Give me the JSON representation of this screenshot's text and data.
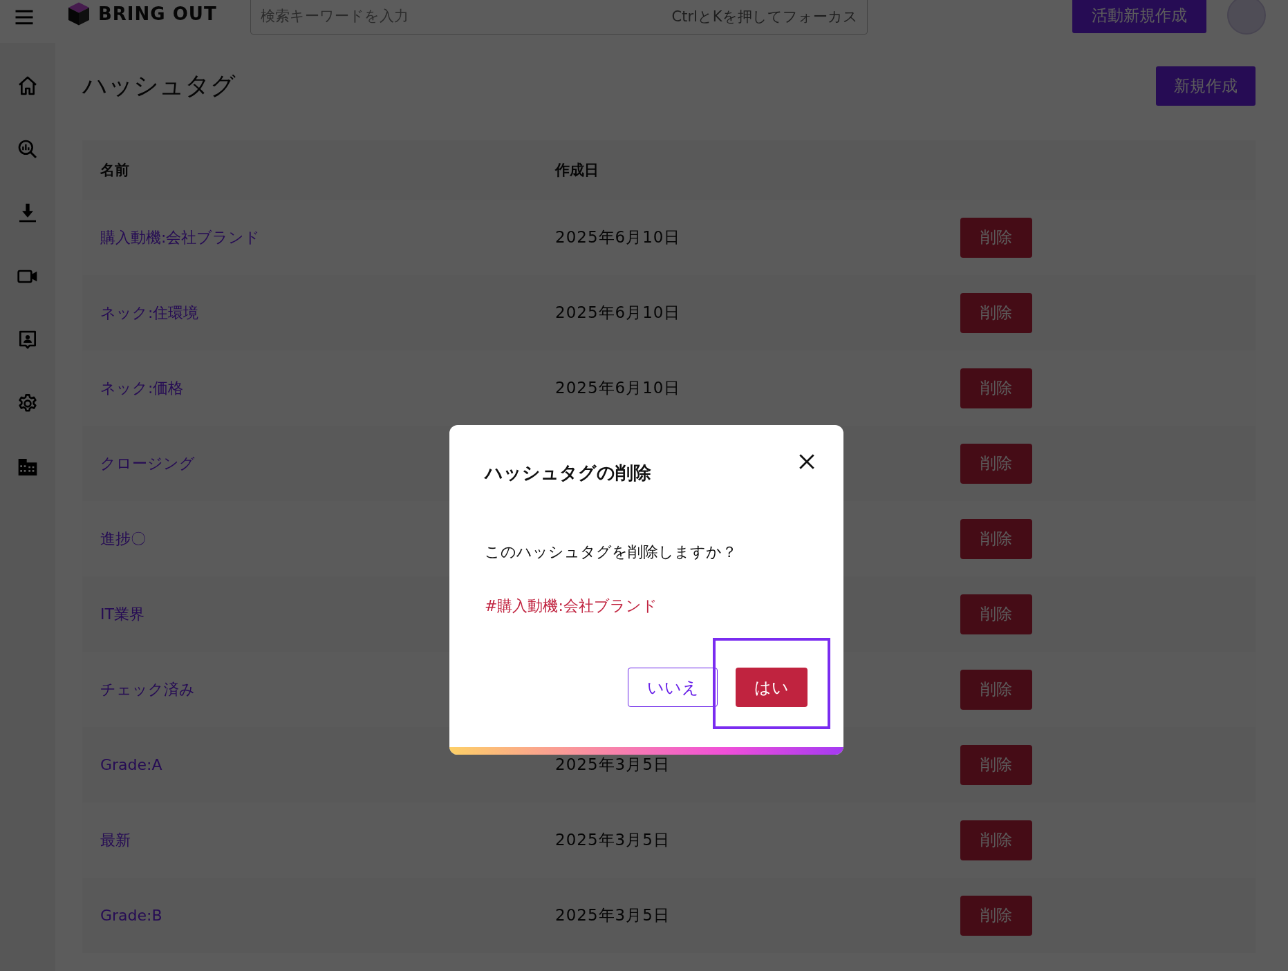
{
  "header": {
    "brand": "BRING OUT",
    "search": {
      "placeholder": "検索キーワードを入力",
      "shortcut_hint": "CtrlとKを押してフォーカス"
    },
    "create_activity_button": "活動新規作成"
  },
  "sidebar": {
    "items": [
      {
        "kind": "home"
      },
      {
        "kind": "analysis"
      },
      {
        "kind": "download"
      },
      {
        "kind": "video"
      },
      {
        "kind": "contact"
      },
      {
        "kind": "settings"
      },
      {
        "kind": "company"
      }
    ]
  },
  "page": {
    "title": "ハッシュタグ",
    "new_button": "新規作成"
  },
  "table": {
    "columns": [
      "名前",
      "作成日"
    ],
    "rows": [
      {
        "name": "購入動機:会社ブランド",
        "created": "2025年6月10日",
        "action": "削除"
      },
      {
        "name": "ネック:住環境",
        "created": "2025年6月10日",
        "action": "削除"
      },
      {
        "name": "ネック:価格",
        "created": "2025年6月10日",
        "action": "削除"
      },
      {
        "name": "クロージング",
        "created": "",
        "action": "削除"
      },
      {
        "name": "進捗〇",
        "created": "",
        "action": "削除"
      },
      {
        "name": "IT業界",
        "created": "",
        "action": "削除"
      },
      {
        "name": "チェック済み",
        "created": "",
        "action": "削除"
      },
      {
        "name": "Grade:A",
        "created": "2025年3月5日",
        "action": "削除"
      },
      {
        "name": "最新",
        "created": "2025年3月5日",
        "action": "削除"
      },
      {
        "name": "Grade:B",
        "created": "2025年3月5日",
        "action": "削除"
      }
    ]
  },
  "dialog": {
    "title": "ハッシュタグの削除",
    "message": "このハッシュタグを削除しますか？",
    "hashtag": "#購入動機:会社ブランド",
    "buttons": [
      {
        "label": "いいえ",
        "kind": "secondary",
        "highlighted": false
      },
      {
        "label": "はい",
        "kind": "danger",
        "highlighted": true
      }
    ]
  }
}
